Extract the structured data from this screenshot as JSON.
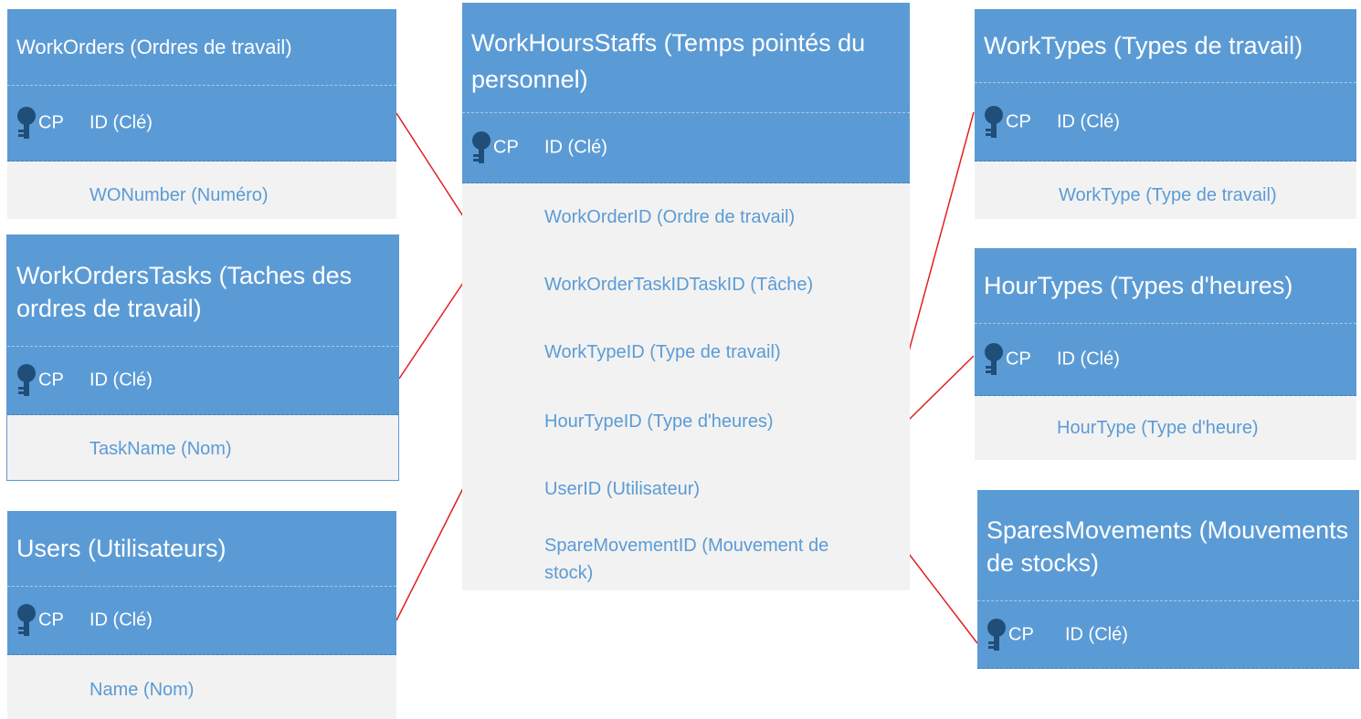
{
  "colors": {
    "header": "#5b9bd5",
    "body": "#f2f2f2",
    "field_text": "#5b9bd5",
    "link": "#e02020"
  },
  "pk_label": "CP",
  "tables": {
    "workorders": {
      "title": "WorkOrders  (Ordres de travail)",
      "pk": "ID (Clé)",
      "fields": [
        "WONumber (Numéro)"
      ]
    },
    "tasks": {
      "title": "WorkOrdersTasks (Taches des ordres de travail)",
      "pk": "ID (Clé)",
      "fields": [
        "TaskName (Nom)"
      ]
    },
    "users": {
      "title": "Users (Utilisateurs)",
      "pk": "ID (Clé)",
      "fields": [
        "Name (Nom)"
      ]
    },
    "staffs": {
      "title": "WorkHoursStaffs (Temps pointés du personnel)",
      "pk": "ID (Clé)",
      "fields": [
        "WorkOrderID (Ordre de travail)",
        "WorkOrderTaskIDTaskID (Tâche)",
        "WorkTypeID (Type de travail)",
        "HourTypeID (Type d'heures)",
        "UserID (Utilisateur)",
        "SpareMovementID (Mouvement de stock)"
      ]
    },
    "worktypes": {
      "title": "WorkTypes (Types de travail)",
      "pk": "ID (Clé)",
      "fields": [
        "WorkType (Type de travail)"
      ]
    },
    "hourtypes": {
      "title": "HourTypes (Types d'heures)",
      "pk": "ID (Clé)",
      "fields": [
        "HourType (Type d'heure)"
      ]
    },
    "spares": {
      "title": "SparesMovements (Mouvements de stocks)",
      "pk": "ID (Clé)",
      "fields": []
    }
  }
}
